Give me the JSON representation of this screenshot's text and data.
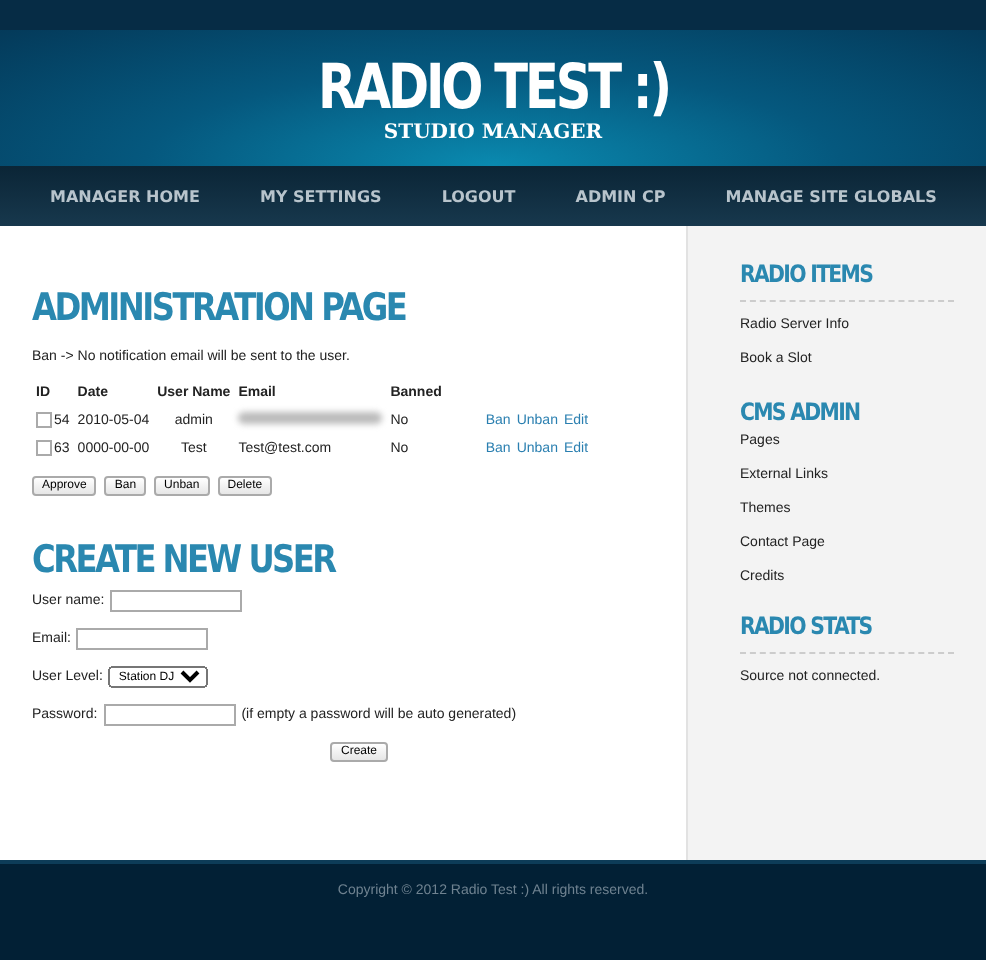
{
  "header": {
    "title": "RADIO TEST :)",
    "subtitle": "STUDIO MANAGER"
  },
  "nav": [
    "MANAGER HOME",
    "MY SETTINGS",
    "LOGOUT",
    "ADMIN CP",
    "MANAGE SITE GLOBALS"
  ],
  "admin": {
    "heading": "ADMINISTRATION PAGE",
    "note": "Ban -> No notification email will be sent to the user.",
    "columns": [
      "ID",
      "Date",
      "User Name",
      "Email",
      "Banned"
    ],
    "rows": [
      {
        "checked": false,
        "id": "54",
        "date": "2010-05-04",
        "user": "admin",
        "email_blurred": true,
        "banned": "No",
        "actions": [
          "Ban",
          "Unban",
          "Edit"
        ]
      },
      {
        "checked": false,
        "id": "63",
        "date": "0000-00-00",
        "user": "Test",
        "email": "Test@test.com",
        "banned": "No",
        "actions": [
          "Ban",
          "Unban",
          "Edit"
        ]
      }
    ],
    "buttons": [
      "Approve",
      "Ban",
      "Unban",
      "Delete"
    ]
  },
  "create": {
    "heading": "CREATE NEW USER",
    "username_label": "User name:",
    "email_label": "Email:",
    "level_label": "User Level:",
    "level_value": "Station DJ",
    "password_label": "Password:",
    "password_hint": "(if empty a password will be auto generated)",
    "button": "Create"
  },
  "sidebar": [
    {
      "heading": "RADIO ITEMS",
      "rule": true,
      "items": [
        "Radio Server Info",
        "Book a Slot"
      ]
    },
    {
      "heading": "CMS ADMIN",
      "rule": false,
      "items": [
        "Pages",
        "External Links",
        "Themes",
        "Contact Page",
        "Credits"
      ]
    },
    {
      "heading": "RADIO STATS",
      "rule": true,
      "items": [
        "Source not connected."
      ]
    }
  ],
  "footer": "Copyright © 2012 Radio Test :) All rights reserved."
}
